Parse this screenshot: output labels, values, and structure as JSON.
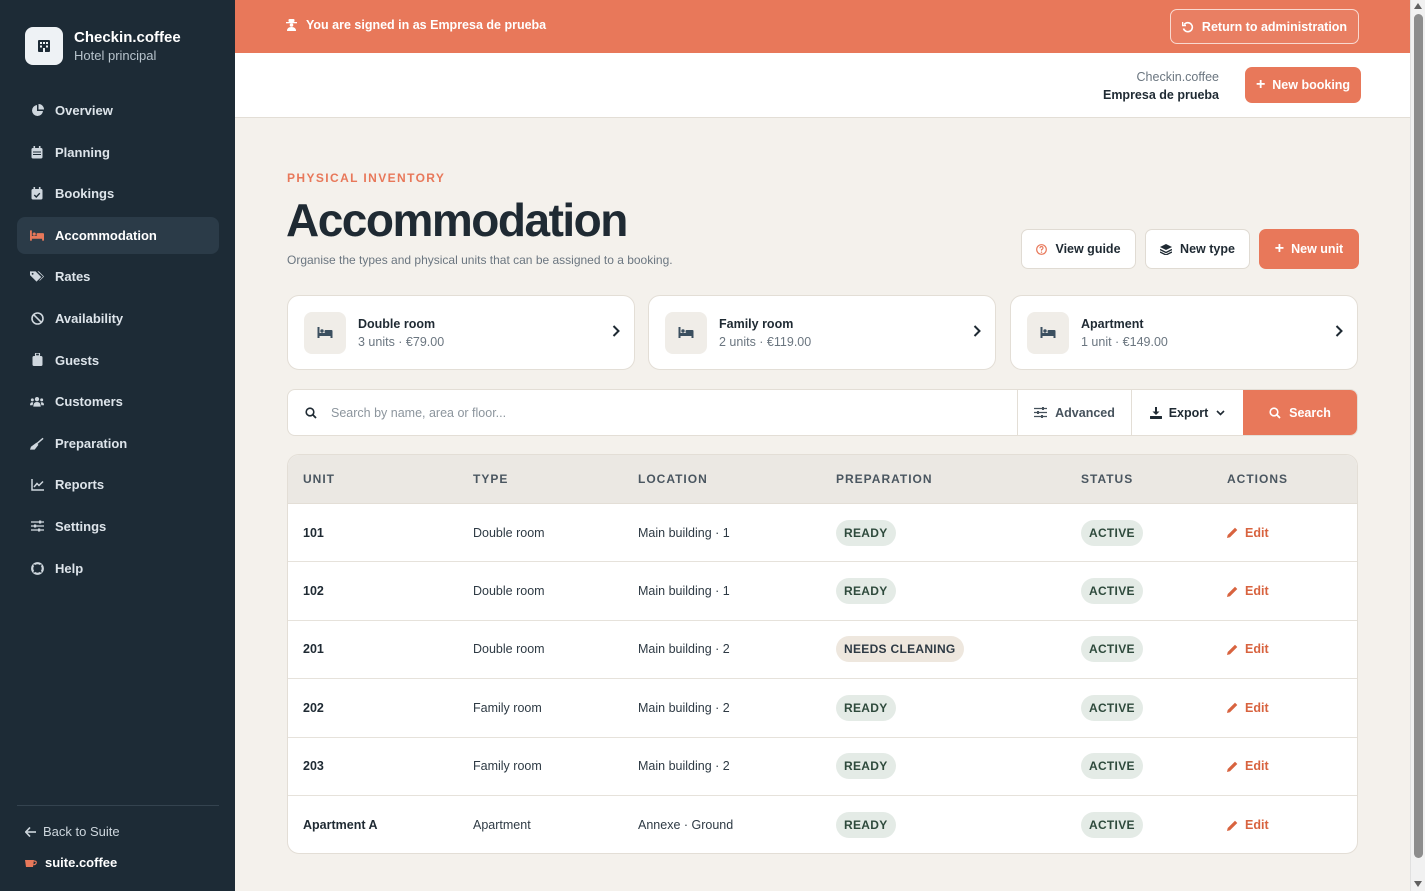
{
  "sidebar": {
    "brand_name": "Checkin.coffee",
    "brand_sub": "Hotel principal",
    "items": [
      {
        "label": "Overview",
        "icon": "pie-chart-icon"
      },
      {
        "label": "Planning",
        "icon": "calendar-icon"
      },
      {
        "label": "Bookings",
        "icon": "calendar-check-icon"
      },
      {
        "label": "Accommodation",
        "icon": "bed-icon"
      },
      {
        "label": "Rates",
        "icon": "tags-icon"
      },
      {
        "label": "Availability",
        "icon": "ban-icon"
      },
      {
        "label": "Guests",
        "icon": "suitcase-icon"
      },
      {
        "label": "Customers",
        "icon": "users-icon"
      },
      {
        "label": "Preparation",
        "icon": "broom-icon"
      },
      {
        "label": "Reports",
        "icon": "chart-line-icon"
      },
      {
        "label": "Settings",
        "icon": "sliders-icon"
      },
      {
        "label": "Help",
        "icon": "life-ring-icon"
      }
    ],
    "active_item": "Accommodation",
    "back_label": "Back to Suite",
    "suite_label": "suite.coffee"
  },
  "banner": {
    "message": "You are signed in as Empresa de prueba",
    "return_label": "Return to administration"
  },
  "topbar": {
    "app_name": "Checkin.coffee",
    "company": "Empresa de prueba",
    "new_booking_label": "New booking"
  },
  "page": {
    "eyebrow": "PHYSICAL INVENTORY",
    "title": "Accommodation",
    "subtitle": "Organise the types and physical units that can be assigned to a booking.",
    "view_guide_label": "View guide",
    "new_type_label": "New type",
    "new_unit_label": "New unit"
  },
  "types": [
    {
      "name": "Double room",
      "meta": "3 units · €79.00"
    },
    {
      "name": "Family room",
      "meta": "2 units · €119.00"
    },
    {
      "name": "Apartment",
      "meta": "1 unit · €149.00"
    }
  ],
  "search": {
    "placeholder": "Search by name, area or floor...",
    "advanced_label": "Advanced",
    "export_label": "Export",
    "search_label": "Search"
  },
  "table": {
    "headers": {
      "unit": "UNIT",
      "type": "TYPE",
      "location": "LOCATION",
      "preparation": "PREPARATION",
      "status": "STATUS",
      "actions": "ACTIONS"
    },
    "rows": [
      {
        "unit": "101",
        "type": "Double room",
        "location": "Main building · 1",
        "preparation": "READY",
        "status": "ACTIVE",
        "action": "Edit"
      },
      {
        "unit": "102",
        "type": "Double room",
        "location": "Main building · 1",
        "preparation": "READY",
        "status": "ACTIVE",
        "action": "Edit"
      },
      {
        "unit": "201",
        "type": "Double room",
        "location": "Main building · 2",
        "preparation": "NEEDS CLEANING",
        "status": "ACTIVE",
        "action": "Edit"
      },
      {
        "unit": "202",
        "type": "Family room",
        "location": "Main building · 2",
        "preparation": "READY",
        "status": "ACTIVE",
        "action": "Edit"
      },
      {
        "unit": "203",
        "type": "Family room",
        "location": "Main building · 2",
        "preparation": "READY",
        "status": "ACTIVE",
        "action": "Edit"
      },
      {
        "unit": "Apartment A",
        "type": "Apartment",
        "location": "Annexe · Ground",
        "preparation": "READY",
        "status": "ACTIVE",
        "action": "Edit"
      }
    ]
  },
  "colors": {
    "accent": "#e8785a",
    "sidebar_bg": "#1d2b36",
    "page_bg": "#f4f1ec"
  }
}
